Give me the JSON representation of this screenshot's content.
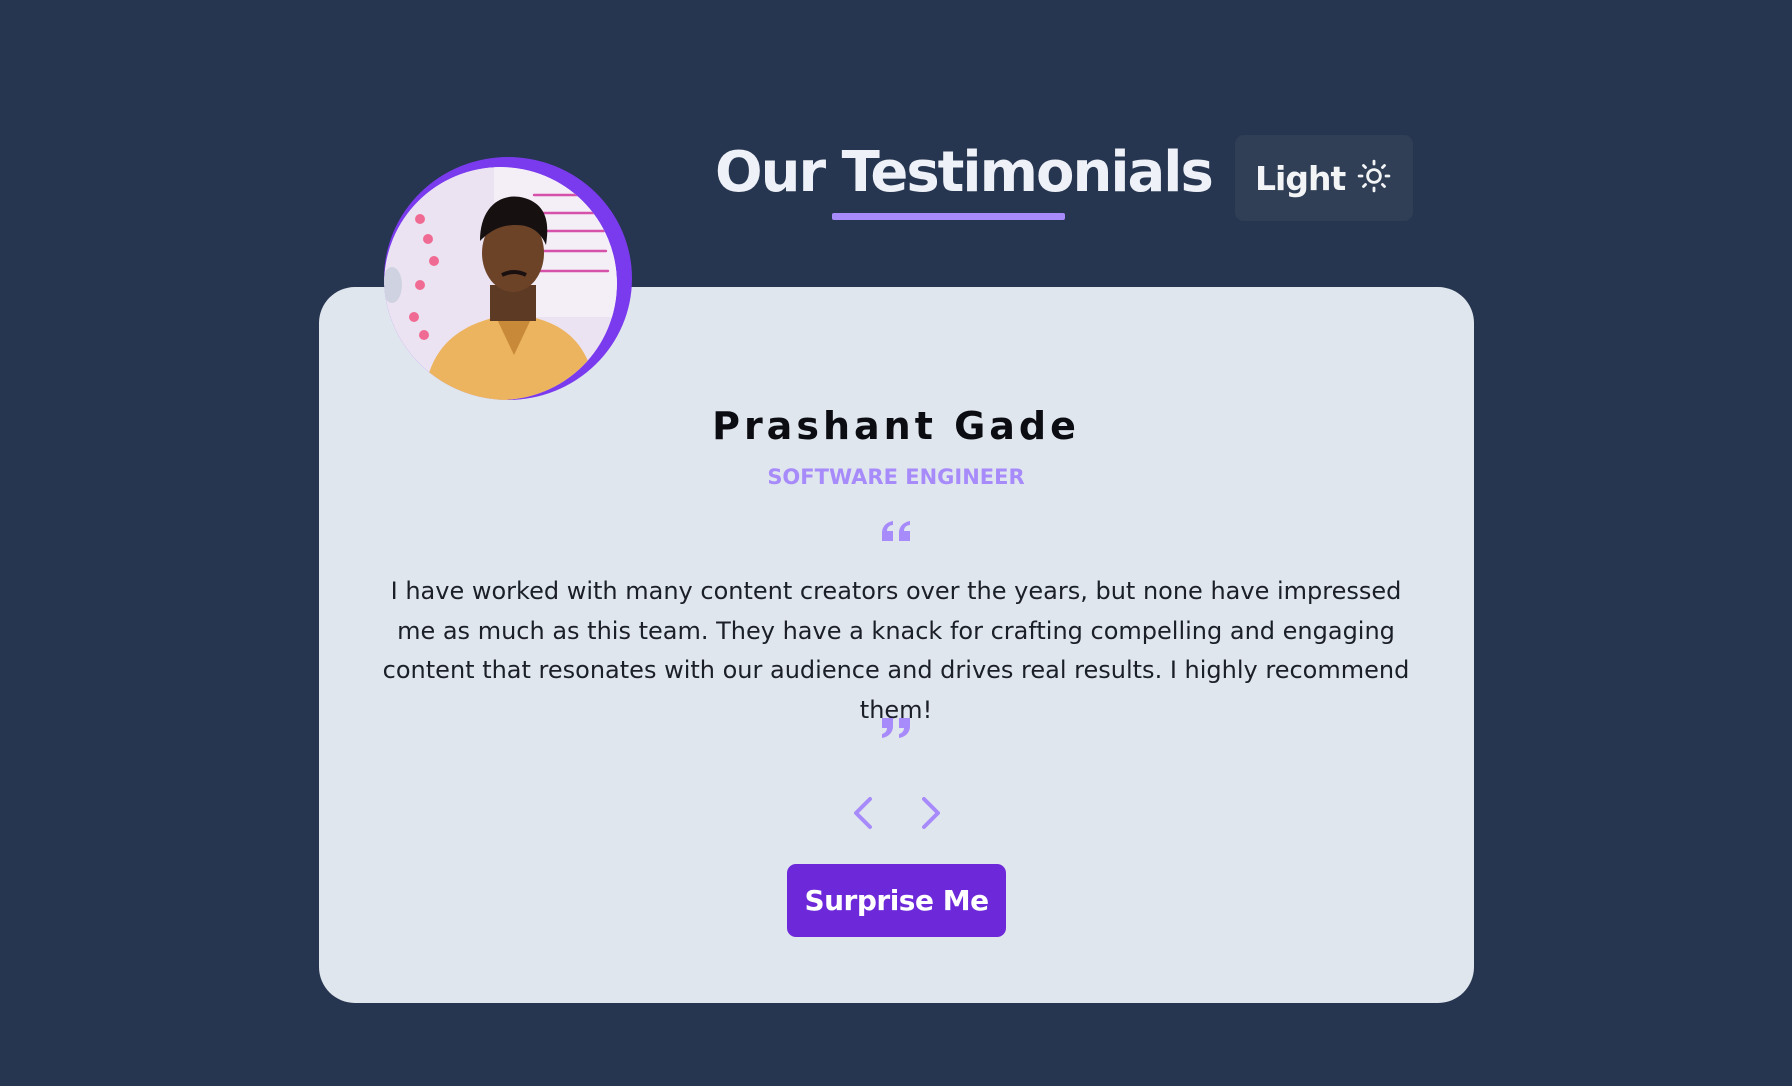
{
  "header": {
    "title": "Our Testimonials",
    "theme_toggle_label": "Light",
    "theme_icon": "sun-icon"
  },
  "testimonial": {
    "name": "Prashant Gade",
    "role": "SOFTWARE ENGINEER",
    "text": "I have worked with many content creators over the years, but none have impressed me as much as this team. They have a knack for crafting compelling and engaging content that resonates with our audience and drives real results. I highly recommend them!",
    "avatar_icon": "avatar-photo"
  },
  "controls": {
    "prev_icon": "chevron-left-icon",
    "next_icon": "chevron-right-icon",
    "surprise_label": "Surprise Me"
  },
  "colors": {
    "background": "#273650",
    "card": "#e0e6ee",
    "accent": "#a78bfa",
    "button": "#6d28d9",
    "toggle_bg": "#303f55"
  }
}
